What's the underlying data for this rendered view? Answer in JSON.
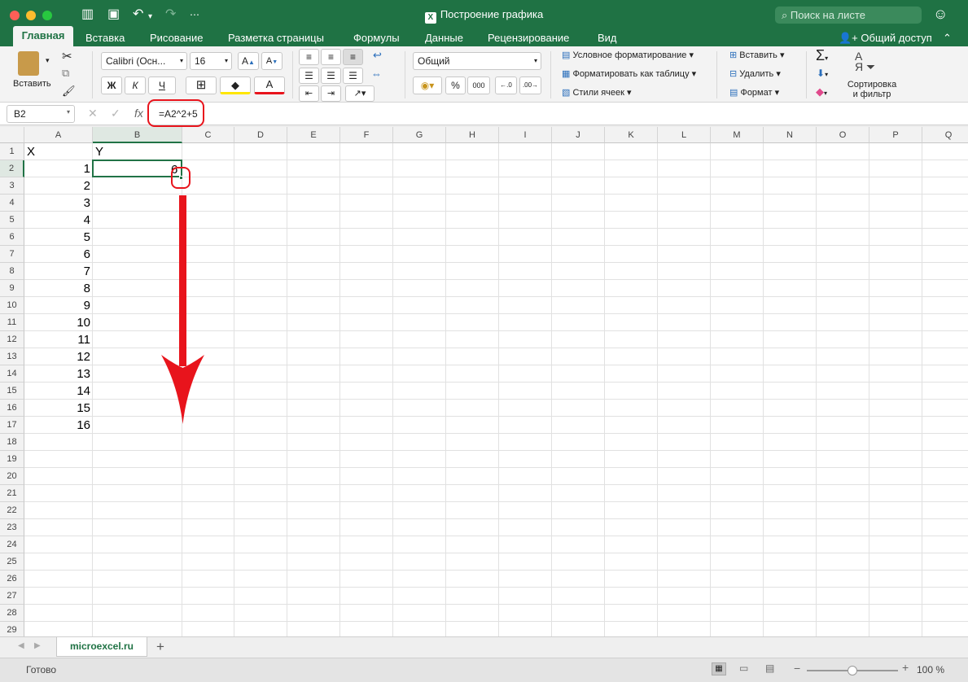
{
  "window": {
    "title": "Построение графика",
    "search_placeholder": "Поиск на листе",
    "traffic_colors": [
      "#fe5f57",
      "#febc2e",
      "#28c840"
    ]
  },
  "tabs": {
    "items": [
      "Главная",
      "Вставка",
      "Рисование",
      "Разметка страницы",
      "Формулы",
      "Данные",
      "Рецензирование",
      "Вид"
    ],
    "share": "Общий доступ"
  },
  "ribbon": {
    "paste": "Вставить",
    "font_name": "Calibri (Осн...",
    "font_size": "16",
    "bold": "Ж",
    "italic": "К",
    "underline": "Ч",
    "number_format": "Общий",
    "percent": "%",
    "thousands": "000",
    "cond_format": "Условное форматирование",
    "format_table": "Форматировать как таблицу",
    "cell_styles": "Стили ячеек",
    "insert": "Вставить",
    "delete": "Удалить",
    "format": "Формат",
    "sort_filter_1": "Сортировка",
    "sort_filter_2": "и фильтр"
  },
  "formula_bar": {
    "name_box": "B2",
    "fx": "fx",
    "formula": "=A2^2+5"
  },
  "grid": {
    "columns": [
      "A",
      "B",
      "C",
      "D",
      "E",
      "F",
      "G",
      "H",
      "I",
      "J",
      "K",
      "L",
      "M",
      "N",
      "O",
      "P",
      "Q"
    ],
    "rows": [
      "1",
      "2",
      "3",
      "4",
      "5",
      "6",
      "7",
      "8",
      "9",
      "10",
      "11",
      "12",
      "13",
      "14",
      "15",
      "16",
      "17",
      "18",
      "19",
      "20",
      "21",
      "22",
      "23",
      "24",
      "25",
      "26",
      "27",
      "28",
      "29"
    ],
    "header_x": "X",
    "header_y": "Y",
    "x_values": [
      "1",
      "2",
      "3",
      "4",
      "5",
      "6",
      "7",
      "8",
      "9",
      "10",
      "11",
      "12",
      "13",
      "14",
      "15",
      "16"
    ],
    "b2_partial": "6"
  },
  "sheet": {
    "tab_name": "microexcel.ru",
    "add": "+"
  },
  "status": {
    "ready": "Готово",
    "zoom": "100 %",
    "zoom_fraction": 0.5
  },
  "accent": {
    "excel_green": "#1f7244",
    "annotation_red": "#e8141c"
  }
}
